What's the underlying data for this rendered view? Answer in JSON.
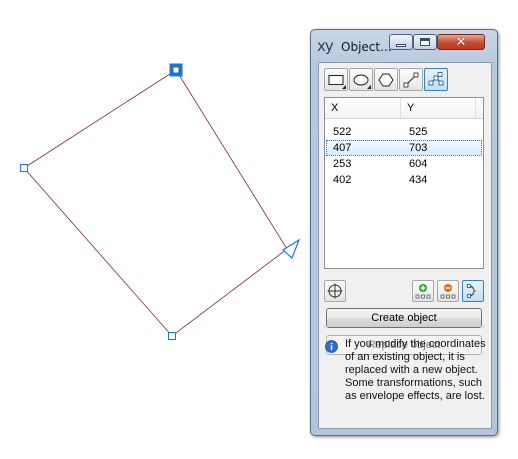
{
  "window": {
    "app_icon": "xy",
    "title": "Object..."
  },
  "toolbar": {
    "tools": [
      "rectangle-icon",
      "ellipse-icon",
      "polygon-icon",
      "line-icon",
      "curve-node-icon"
    ],
    "active_tool": "curve-node-icon"
  },
  "table": {
    "columns": [
      "X",
      "Y"
    ],
    "rows": [
      {
        "x": "522",
        "y": "525"
      },
      {
        "x": "407",
        "y": "703"
      },
      {
        "x": "253",
        "y": "604"
      },
      {
        "x": "402",
        "y": "434"
      }
    ],
    "selected_row": 1
  },
  "actions": {
    "create_label": "Create object",
    "replace_label": "Replace object"
  },
  "info": {
    "text": "If you modify the coordinates of an existing object, it is replaced with a new object.  Some transformations, such as envelope effects, are lost."
  },
  "colors": {
    "accent": "#1e78d2",
    "outline": "#7a2a2a"
  }
}
